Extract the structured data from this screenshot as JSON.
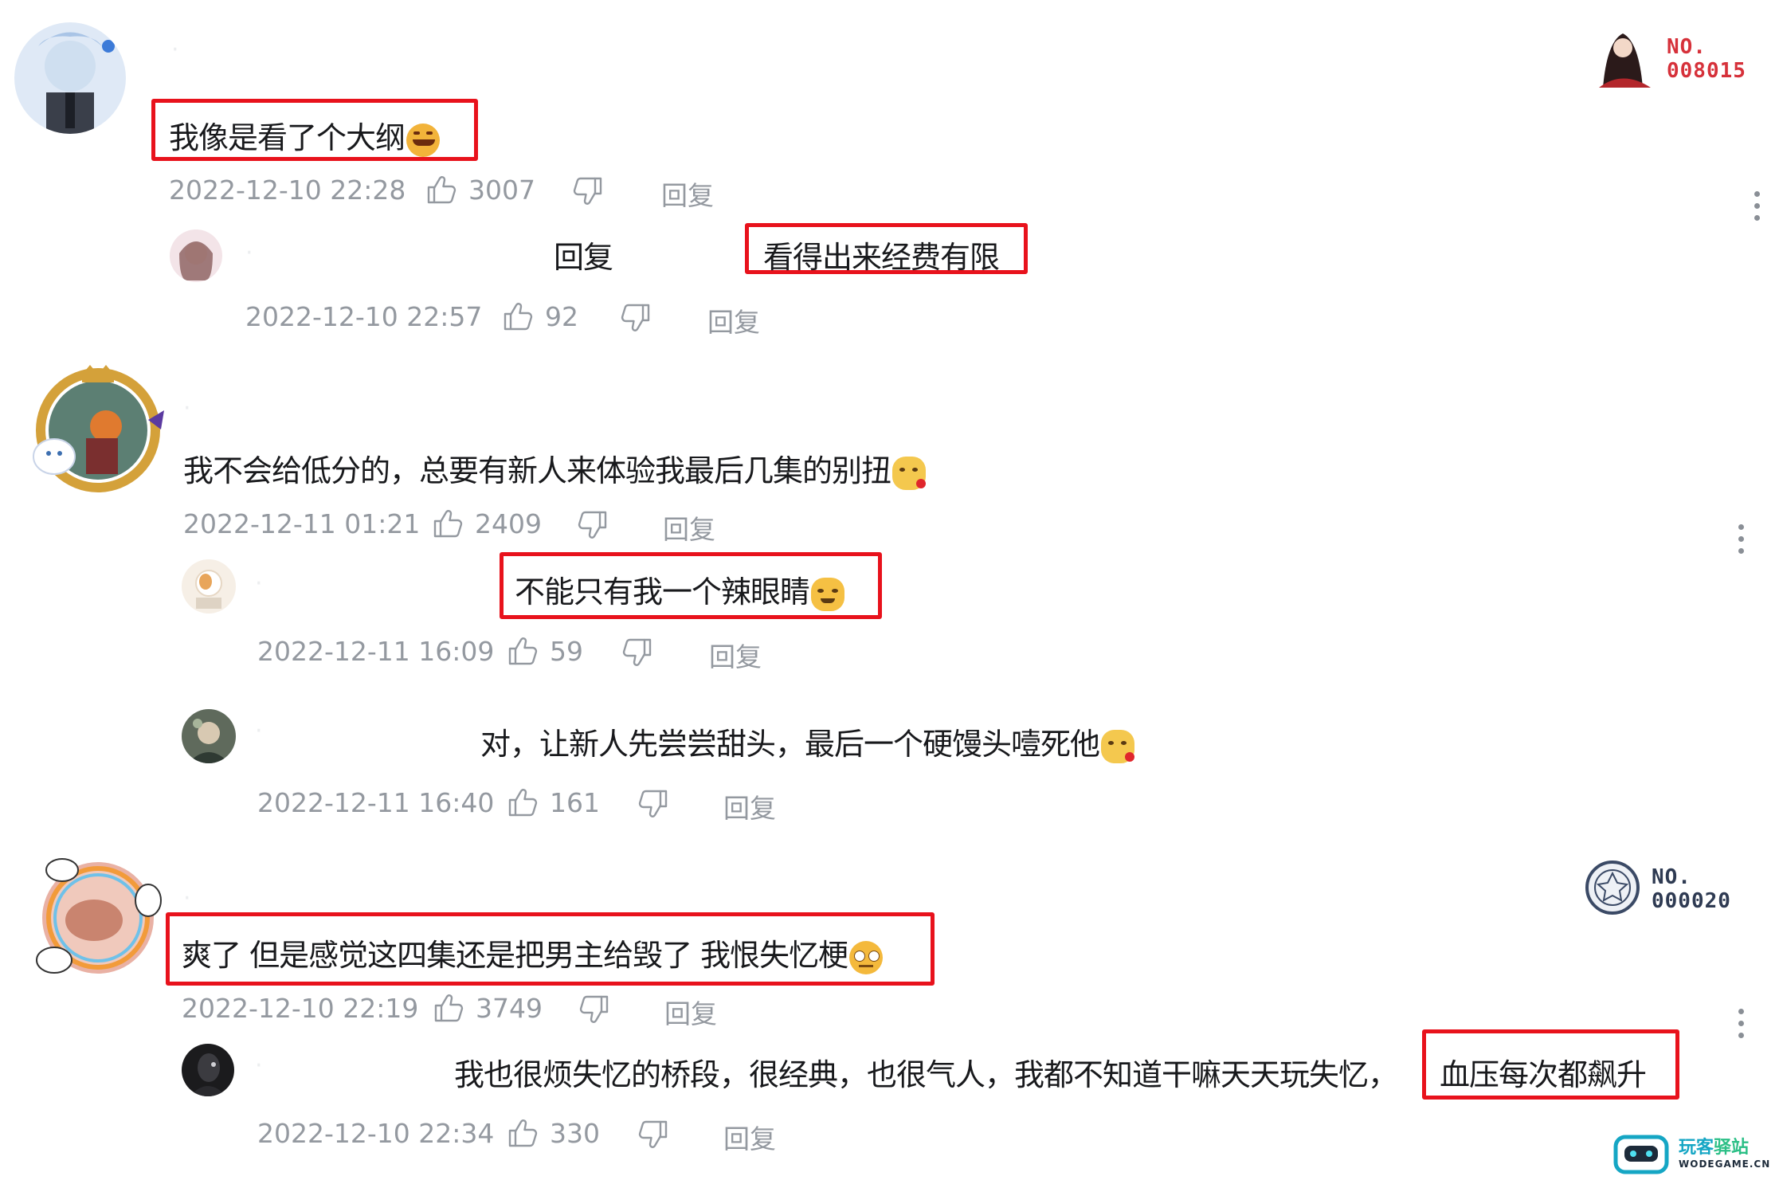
{
  "reply_label": "回复",
  "inline_reply_word": "回复",
  "comments": [
    {
      "text": "我像是看了个大纲",
      "emoji": "grin-emoji",
      "time": "2022-12-10 22:28",
      "likes": "3007",
      "badge_no": [
        "NO.",
        "008015"
      ],
      "replies": [
        {
          "text": "看得出来经费有限",
          "time": "2022-12-10 22:57",
          "likes": "92"
        }
      ]
    },
    {
      "text": "我不会给低分的，总要有新人来体验我最后几集的别扭",
      "emoji": "cat-emoji",
      "time": "2022-12-11 01:21",
      "likes": "2409",
      "replies": [
        {
          "text": "不能只有我一个辣眼睛",
          "time": "2022-12-11 16:09",
          "likes": "59"
        },
        {
          "text": "对，让新人先尝尝甜头，最后一个硬馒头噎死他",
          "time": "2022-12-11 16:40",
          "likes": "161"
        }
      ]
    },
    {
      "text": "爽了 但是感觉这四集还是把男主给毁了 我恨失忆梗",
      "emoji": "rolleyes-emoji",
      "time": "2022-12-10 22:19",
      "likes": "3749",
      "badge_no": [
        "NO.",
        "000020"
      ],
      "replies": [
        {
          "text_a": "我也很烦失忆的桥段，很经典，也很气人，我都不知道干嘛天天玩失忆，",
          "text_b": "血压每次都飙升",
          "time": "2022-12-10 22:34",
          "likes": "330"
        }
      ]
    }
  ],
  "watermark": {
    "cn_a": "玩客",
    "cn_b": "驿站",
    "domain": "WODEGAME.CN"
  },
  "colors": {
    "highlight": "#e8121c",
    "meta": "#9499a0",
    "text": "#18191c",
    "brand_teal": "#15a6c4"
  }
}
